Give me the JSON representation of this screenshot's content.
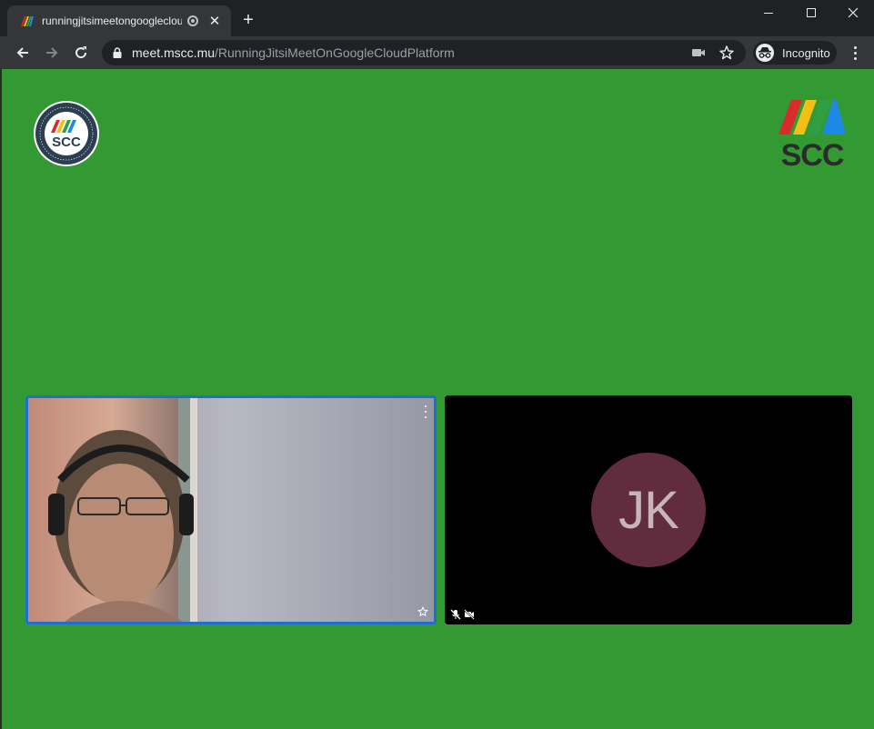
{
  "browser": {
    "tab": {
      "title": "runningjitsimeetongooglecloudplatform"
    },
    "url": {
      "host": "meet.mscc.mu",
      "path": "/RunningJitsiMeetOnGoogleCloudPlatform"
    },
    "incognito_label": "Incognito",
    "icons": [
      "back-arrow-icon",
      "forward-arrow-icon",
      "reload-icon",
      "lock-icon",
      "camera-icon",
      "star-icon",
      "incognito-icon",
      "more-vert-icon"
    ]
  },
  "meeting": {
    "logos": {
      "left_text": "SCC",
      "right_text": "SCC"
    },
    "participants": [
      {
        "type": "local",
        "pinned_icon": "star-icon"
      },
      {
        "type": "remote",
        "initials": "JK",
        "avatar_color": "#622c3f",
        "muted": true,
        "video_off": true
      }
    ],
    "colors": {
      "background": "#339933",
      "active_border": "#1e6fd0"
    }
  }
}
